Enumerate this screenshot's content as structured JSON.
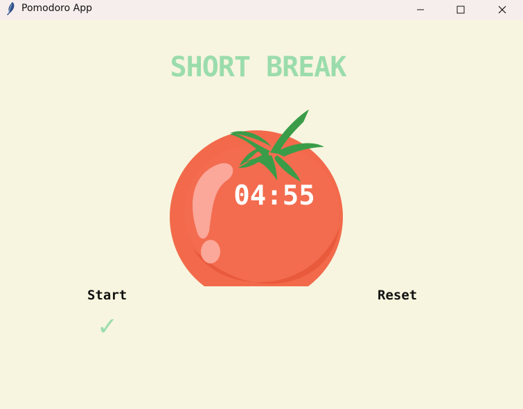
{
  "window": {
    "title": "Pomodoro App",
    "app_icon": "feather-icon",
    "controls": {
      "minimize": "minimize-icon",
      "maximize": "maximize-icon",
      "close": "close-icon"
    }
  },
  "main": {
    "heading": "SHORT BREAK",
    "timer": "04:55",
    "start_label": "Start",
    "reset_label": "Reset",
    "checkmarks": "✓",
    "tomato_icon": "tomato-icon"
  },
  "colors": {
    "background": "#f7f5df",
    "heading_green": "#9bdcac",
    "tomato_red": "#f26a4b",
    "leaf_green": "#3a9c48"
  }
}
